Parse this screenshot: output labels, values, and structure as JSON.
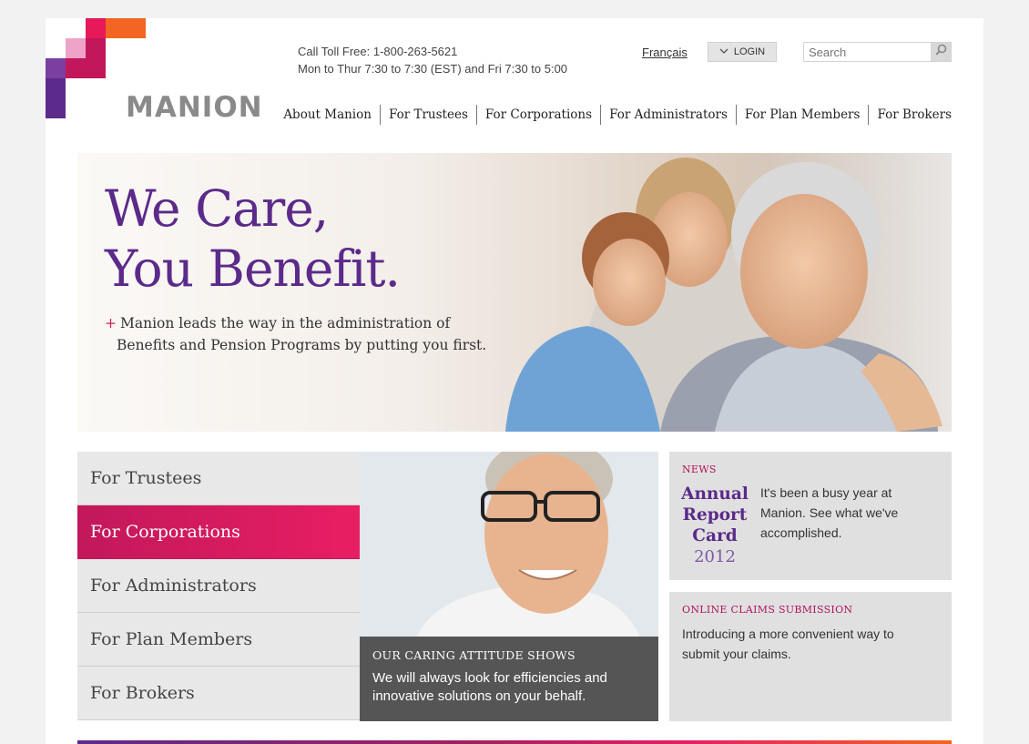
{
  "brand": {
    "name": "MANION",
    "colors": {
      "purple": "#5b2a8a",
      "magenta": "#d81b60",
      "orange": "#f26522",
      "gray": "#8a8a8a"
    }
  },
  "header": {
    "phone_line": "Call Toll Free: 1-800-263-5621",
    "hours_line": "Mon to Thur 7:30 to 7:30 (EST) and Fri 7:30 to 5:00",
    "language_link": "Français",
    "login_label": "LOGIN",
    "search_placeholder": "Search"
  },
  "nav": {
    "items": [
      {
        "label": "About Manion"
      },
      {
        "label": "For Trustees"
      },
      {
        "label": "For Corporations"
      },
      {
        "label": "For Administrators"
      },
      {
        "label": "For Plan Members"
      },
      {
        "label": "For Brokers"
      }
    ]
  },
  "hero": {
    "headline_line1": "We Care,",
    "headline_line2": "You Benefit.",
    "tagline_line1": "Manion leads the way in the administration of",
    "tagline_line2": "Benefits and Pension Programs by putting you first.",
    "tagline_marker": "+"
  },
  "side_menu": {
    "active_index": 1,
    "items": [
      {
        "label": "For Trustees"
      },
      {
        "label": "For Corporations"
      },
      {
        "label": "For Administrators"
      },
      {
        "label": "For Plan Members"
      },
      {
        "label": "For Brokers"
      }
    ]
  },
  "feature": {
    "heading": "OUR CARING ATTITUDE SHOWS",
    "body": "We will always look for efficiencies and innovative solutions on your behalf."
  },
  "news": {
    "label": "NEWS",
    "badge_line1": "Annual",
    "badge_line2": "Report",
    "badge_line3": "Card",
    "badge_year": "2012",
    "text": "It's been a busy year at Manion. See what we've accomplished."
  },
  "claims": {
    "label": "ONLINE CLAIMS SUBMISSION",
    "text": "Introducing a more convenient way to submit your claims."
  }
}
